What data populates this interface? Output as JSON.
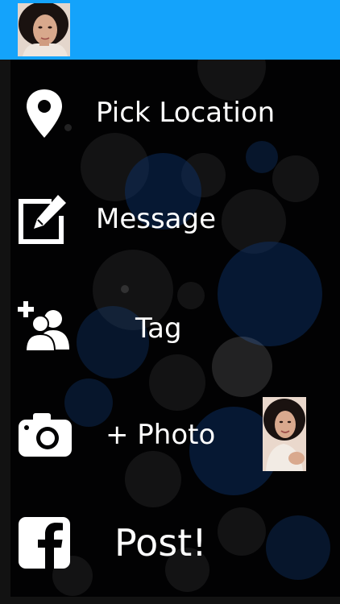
{
  "header": {
    "avatar_icon": "profile-photo"
  },
  "menu": {
    "pick_location": {
      "label": "Pick Location",
      "icon": "map-pin-icon"
    },
    "message": {
      "label": "Message",
      "icon": "compose-icon"
    },
    "tag": {
      "label": "Tag",
      "icon": "add-friends-icon"
    },
    "photo": {
      "label": "+ Photo",
      "icon": "camera-icon"
    },
    "post": {
      "label": "Post!",
      "icon": "facebook-icon"
    }
  },
  "colors": {
    "header": "#14a3fb",
    "background": "#020203",
    "text": "#ffffff"
  }
}
